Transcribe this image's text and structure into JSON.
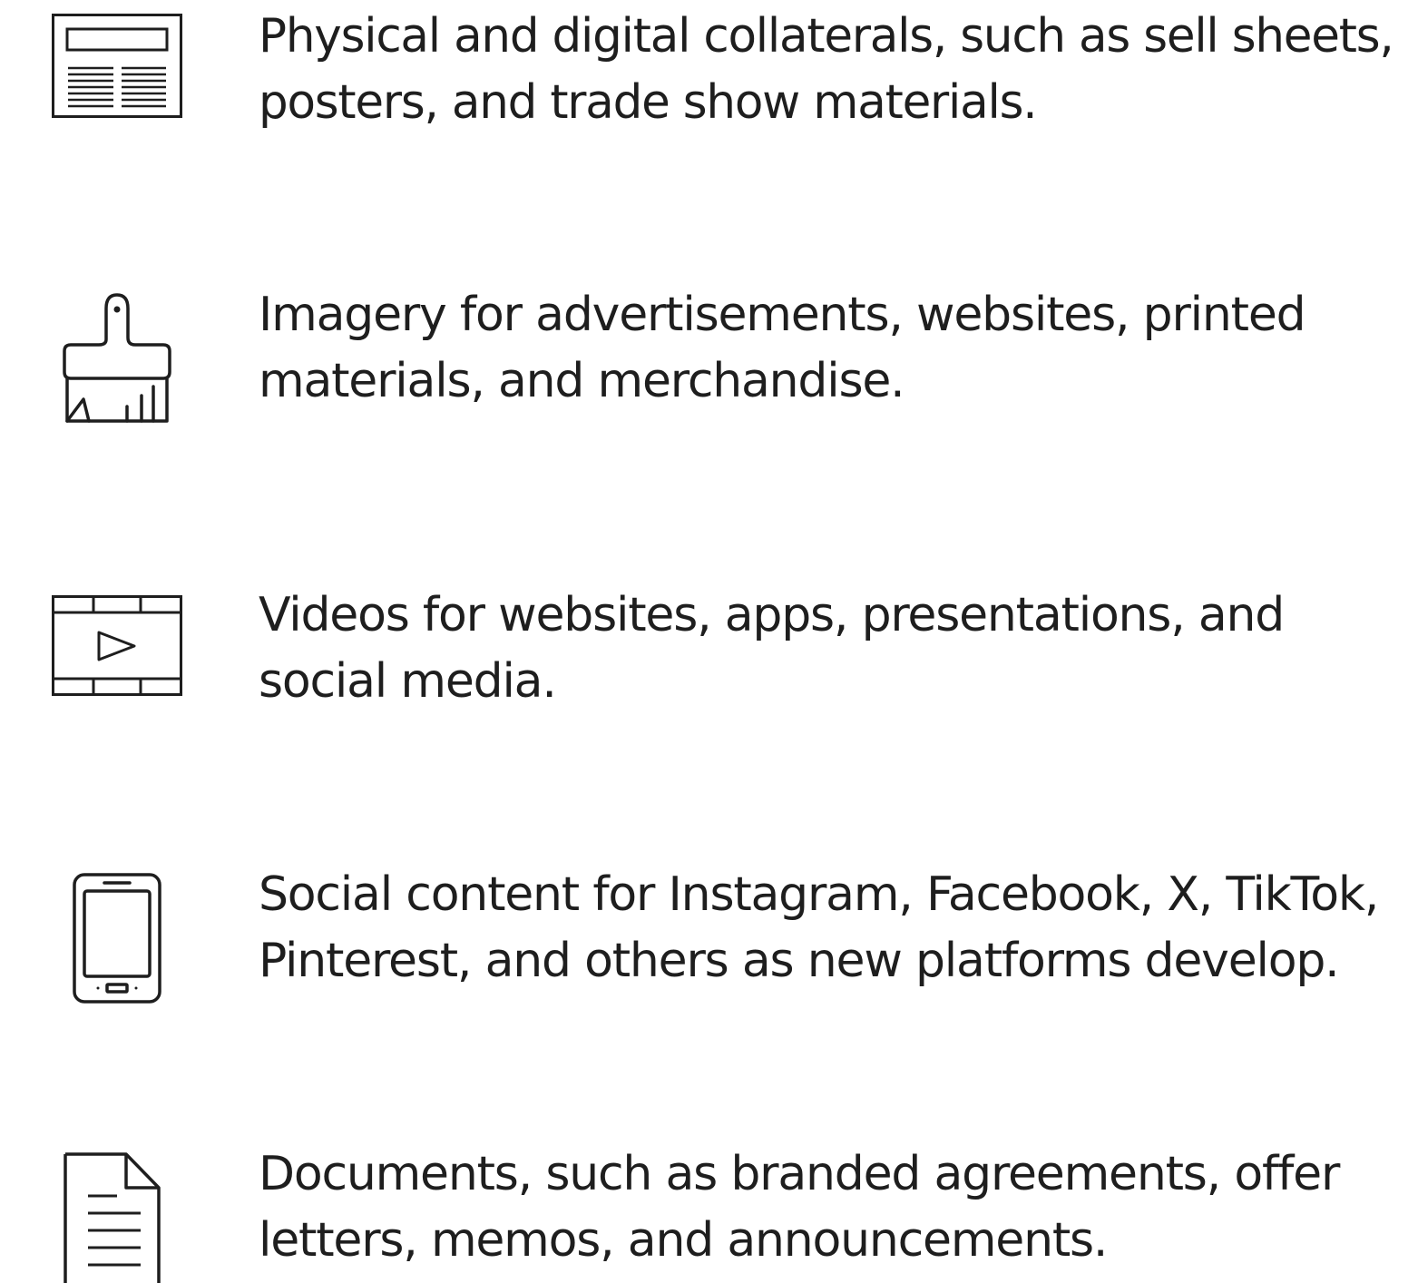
{
  "theme": {
    "text_color": "#1e1e1e",
    "icon_color": "#1e1e1e",
    "background": "#ffffff"
  },
  "items": [
    {
      "icon": "layout-icon",
      "line1": "Physical and digital collaterals, such as sell sheets,",
      "line2": "posters, and trade show materials."
    },
    {
      "icon": "paintbrush-icon",
      "line1": "Imagery for advertisements, websites, printed",
      "line2": "materials, and merchandise."
    },
    {
      "icon": "video-icon",
      "line1": "Videos for websites, apps, presentations, and",
      "line2": "social media."
    },
    {
      "icon": "mobile-icon",
      "line1": "Social content for Instagram, Facebook, X, TikTok,",
      "line2": "Pinterest, and others as new platforms develop."
    },
    {
      "icon": "document-icon",
      "line1": "Documents, such as branded agreements, offer",
      "line2": "letters, memos, and announcements."
    }
  ]
}
